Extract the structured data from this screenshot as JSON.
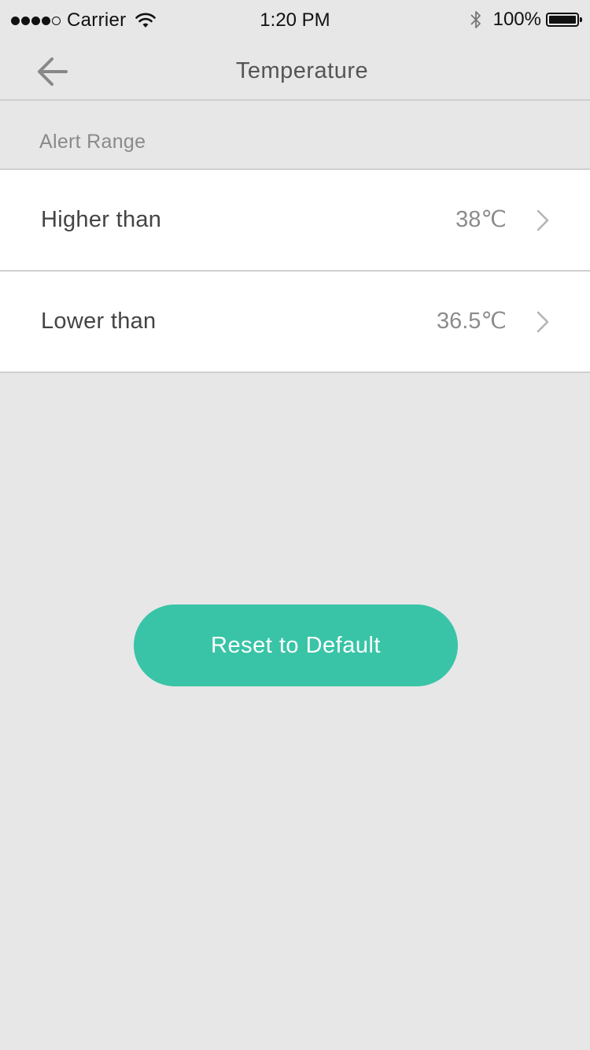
{
  "status_bar": {
    "carrier": "Carrier",
    "time": "1:20 PM",
    "battery_percent": "100%",
    "signal_strength": 4,
    "signal_max": 5,
    "battery_level": 1.0,
    "icons": [
      "wifi-icon",
      "bluetooth-icon",
      "battery-icon"
    ]
  },
  "nav": {
    "title": "Temperature",
    "back_icon": "arrow-left-icon"
  },
  "section": {
    "title": "Alert Range"
  },
  "rows": [
    {
      "label": "Higher than",
      "value": "38℃",
      "icon": "chevron-right-icon"
    },
    {
      "label": "Lower than",
      "value": "36.5℃",
      "icon": "chevron-right-icon"
    }
  ],
  "actions": {
    "reset_label": "Reset to Default"
  },
  "colors": {
    "background": "#e7e7e7",
    "accent": "#39c4a7",
    "row_background": "#ffffff",
    "separator": "#cfcfcf"
  }
}
